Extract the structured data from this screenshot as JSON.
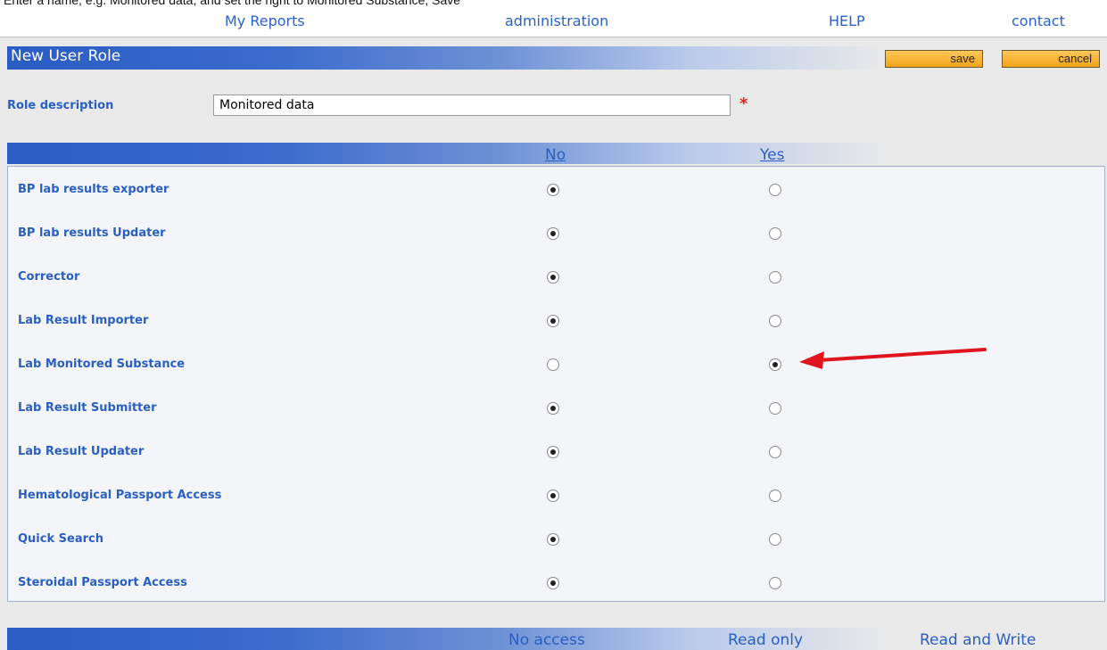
{
  "instruction": "Enter a name, e.g. Monitored data, and set the right to Monitored Substance, Save",
  "nav": {
    "my_reports": "My Reports",
    "administration": "administration",
    "help": "HELP",
    "contact": "contact"
  },
  "header": {
    "title": "New User Role",
    "save_label": "save",
    "cancel_label": "cancel"
  },
  "form": {
    "role_description_label": "Role description",
    "role_description_value": "Monitored data",
    "required_marker": "*"
  },
  "permissions": {
    "col_no": "No",
    "col_yes": "Yes",
    "rows": [
      {
        "label": "BP lab results exporter",
        "value": "No"
      },
      {
        "label": "BP lab results Updater",
        "value": "No"
      },
      {
        "label": "Corrector",
        "value": "No"
      },
      {
        "label": "Lab Result Importer",
        "value": "No"
      },
      {
        "label": "Lab Monitored Substance",
        "value": "Yes"
      },
      {
        "label": "Lab Result Submitter",
        "value": "No"
      },
      {
        "label": "Lab Result Updater",
        "value": "No"
      },
      {
        "label": "Hematological Passport Access",
        "value": "No"
      },
      {
        "label": "Quick Search",
        "value": "No"
      },
      {
        "label": "Steroidal Passport Access",
        "value": "No"
      }
    ]
  },
  "footer": {
    "no_access": "No access",
    "read_only": "Read only",
    "read_write": "Read and Write"
  },
  "colors": {
    "accent_blue": "#2a5fc2",
    "button_orange": "#f3a418",
    "arrow_red": "#e0141e"
  }
}
